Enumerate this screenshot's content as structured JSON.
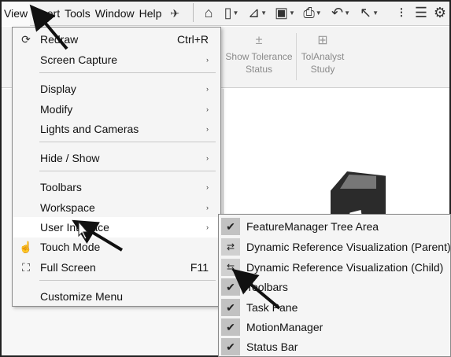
{
  "menubar": {
    "items": [
      "View",
      "Insert",
      "Tools",
      "Window",
      "Help"
    ],
    "toolbar_icons": [
      "pin-icon",
      "home-icon",
      "new-document-icon",
      "open-icon",
      "save-icon",
      "print-icon",
      "undo-icon",
      "select-cursor-icon",
      "traffic-light-icon",
      "options-list-icon",
      "settings-gear-icon"
    ]
  },
  "ribbon": {
    "show_tolerance": [
      "Show Tolerance",
      "Status"
    ],
    "tolanalyst": [
      "TolAnalyst",
      "Study"
    ]
  },
  "view_menu": {
    "items": [
      {
        "label": "Redraw",
        "shortcut": "Ctrl+R",
        "icon": "redraw-icon"
      },
      {
        "label": "Screen Capture",
        "submenu": true
      },
      {
        "label": "Display",
        "submenu": true
      },
      {
        "label": "Modify",
        "submenu": true
      },
      {
        "label": "Lights and Cameras",
        "submenu": true
      },
      {
        "label": "Hide / Show",
        "submenu": true
      },
      {
        "label": "Toolbars",
        "submenu": true
      },
      {
        "label": "Workspace",
        "submenu": true
      },
      {
        "label": "User Interface",
        "submenu": true,
        "highlighted": true
      },
      {
        "label": "Touch Mode",
        "icon": "touch-hand-icon"
      },
      {
        "label": "Full Screen",
        "shortcut": "F11",
        "icon": "fullscreen-icon"
      },
      {
        "label": "Customize Menu"
      }
    ]
  },
  "user_interface_submenu": {
    "items": [
      {
        "label": "FeatureManager Tree Area",
        "checked": true
      },
      {
        "label": "Dynamic Reference Visualization (Parent)",
        "icon": "reference-parent-icon"
      },
      {
        "label": "Dynamic Reference Visualization (Child)",
        "icon": "reference-child-icon"
      },
      {
        "label": "Toolbars",
        "checked": true
      },
      {
        "label": "Task Pane",
        "checked": true
      },
      {
        "label": "MotionManager",
        "checked": true
      },
      {
        "label": "Status Bar",
        "checked": true
      }
    ]
  },
  "glyphs": {
    "check": "✔",
    "submenu_arrow": "›"
  },
  "colors": {
    "menu_bg": "#f5f5f5",
    "highlight": "#ffffff",
    "check_cell": "#c9c9c9",
    "arrow": "#1a1a1a"
  }
}
